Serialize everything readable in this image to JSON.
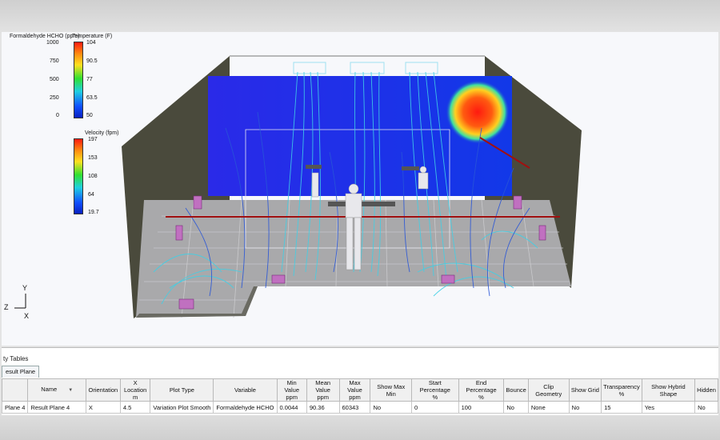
{
  "legends": {
    "hcho": {
      "title": "Formaldehyde HCHO (ppm)",
      "ticks": [
        "1000",
        "750",
        "500",
        "250",
        "0"
      ]
    },
    "temperature": {
      "title": "Temperature (F)",
      "ticks": [
        "104",
        "90.5",
        "77",
        "63.5",
        "50"
      ]
    },
    "velocity": {
      "title": "Velocity (fpm)",
      "ticks": [
        "197",
        "153",
        "108",
        "64",
        "19.7"
      ]
    }
  },
  "axes": {
    "y": "Y",
    "z": "Z",
    "x": "X"
  },
  "panel": {
    "title": "ty Tables",
    "tab": "esult Plane",
    "columns": [
      "",
      "Name",
      "Orientation",
      "X Location\nm",
      "Plot Type",
      "Variable",
      "Min Value\nppm",
      "Mean Value\nppm",
      "Max Value\nppm",
      "Show Max Min",
      "Start Percentage\n%",
      "End Percentage\n%",
      "Bounce",
      "Clip Geometry",
      "Show Grid",
      "Transparency\n%",
      "Show Hybrid Shape",
      "Hidden"
    ],
    "row": [
      "Plane 4",
      "Result Plane 4",
      "X",
      "4.5",
      "Variation Plot Smooth",
      "Formaldehyde HCHO",
      "0.0044",
      "90.36",
      "60343",
      "No",
      "0",
      "100",
      "No",
      "None",
      "No",
      "15",
      "Yes",
      "No"
    ]
  },
  "colors": {
    "wall_dark": "#4a4a3c",
    "back_plane": "#1233e0",
    "floor": "#a9a9ab",
    "hotspot": "#ff2a10",
    "streamline_cyan": "#3fd0e6",
    "streamline_blue": "#2855d8"
  }
}
